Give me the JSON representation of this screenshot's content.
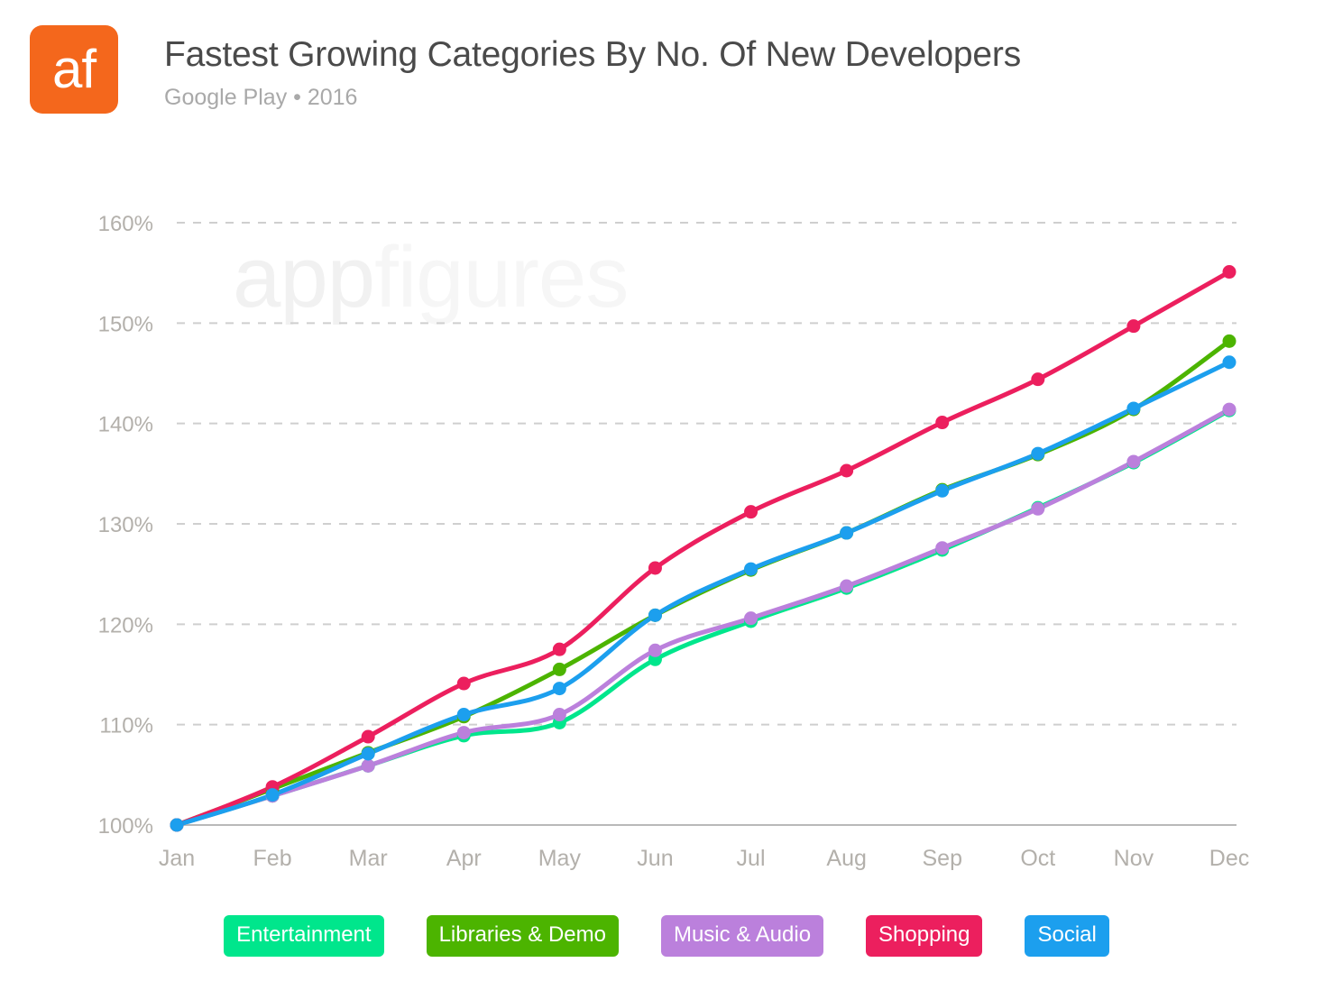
{
  "header": {
    "logo_text": "af",
    "logo_color": "#F4671C",
    "title": "Fastest Growing Categories By No. Of New Developers",
    "subtitle": "Google Play • 2016"
  },
  "watermark": {
    "part_a": "app",
    "part_b": "figures"
  },
  "legend": {
    "position": "bottom-center",
    "items": [
      {
        "label": "Entertainment",
        "color": "#00E68C"
      },
      {
        "label": "Libraries & Demo",
        "color": "#4CB400"
      },
      {
        "label": "Music & Audio",
        "color": "#BB80DC"
      },
      {
        "label": "Shopping",
        "color": "#EC1F5E"
      },
      {
        "label": "Social",
        "color": "#1C9FEE"
      }
    ]
  },
  "chart_data": {
    "type": "line",
    "title": "Fastest Growing Categories By No. Of New Developers",
    "subtitle": "Google Play • 2016",
    "xlabel": "",
    "ylabel": "",
    "grid": true,
    "ylim": [
      100,
      160
    ],
    "ytick_step": 10,
    "ytick_labels": [
      "100%",
      "110%",
      "120%",
      "130%",
      "140%",
      "150%",
      "160%"
    ],
    "ytick_values": [
      100,
      110,
      120,
      130,
      140,
      150,
      160
    ],
    "categories": [
      "Jan",
      "Feb",
      "Mar",
      "Apr",
      "May",
      "Jun",
      "Jul",
      "Aug",
      "Sep",
      "Oct",
      "Nov",
      "Dec"
    ],
    "series": [
      {
        "name": "Entertainment",
        "color": "#00E68C",
        "values": [
          100.0,
          102.9,
          105.9,
          108.9,
          110.2,
          116.5,
          120.3,
          123.6,
          127.4,
          131.6,
          136.1,
          141.3
        ]
      },
      {
        "name": "Libraries & Demo",
        "color": "#4CB400",
        "values": [
          100.0,
          103.6,
          107.2,
          110.8,
          115.5,
          120.9,
          125.4,
          129.1,
          133.4,
          136.9,
          141.4,
          148.2
        ]
      },
      {
        "name": "Music & Audio",
        "color": "#BB80DC",
        "values": [
          100.0,
          102.9,
          105.9,
          109.2,
          111.0,
          117.4,
          120.6,
          123.8,
          127.6,
          131.5,
          136.2,
          141.4
        ]
      },
      {
        "name": "Shopping",
        "color": "#EC1F5E",
        "values": [
          100.0,
          103.8,
          108.8,
          114.1,
          117.5,
          125.6,
          131.2,
          135.3,
          140.1,
          144.4,
          149.7,
          155.1
        ]
      },
      {
        "name": "Social",
        "color": "#1C9FEE",
        "values": [
          100.0,
          103.0,
          107.1,
          111.0,
          113.6,
          120.9,
          125.5,
          129.1,
          133.3,
          137.0,
          141.5,
          146.1
        ]
      }
    ]
  }
}
